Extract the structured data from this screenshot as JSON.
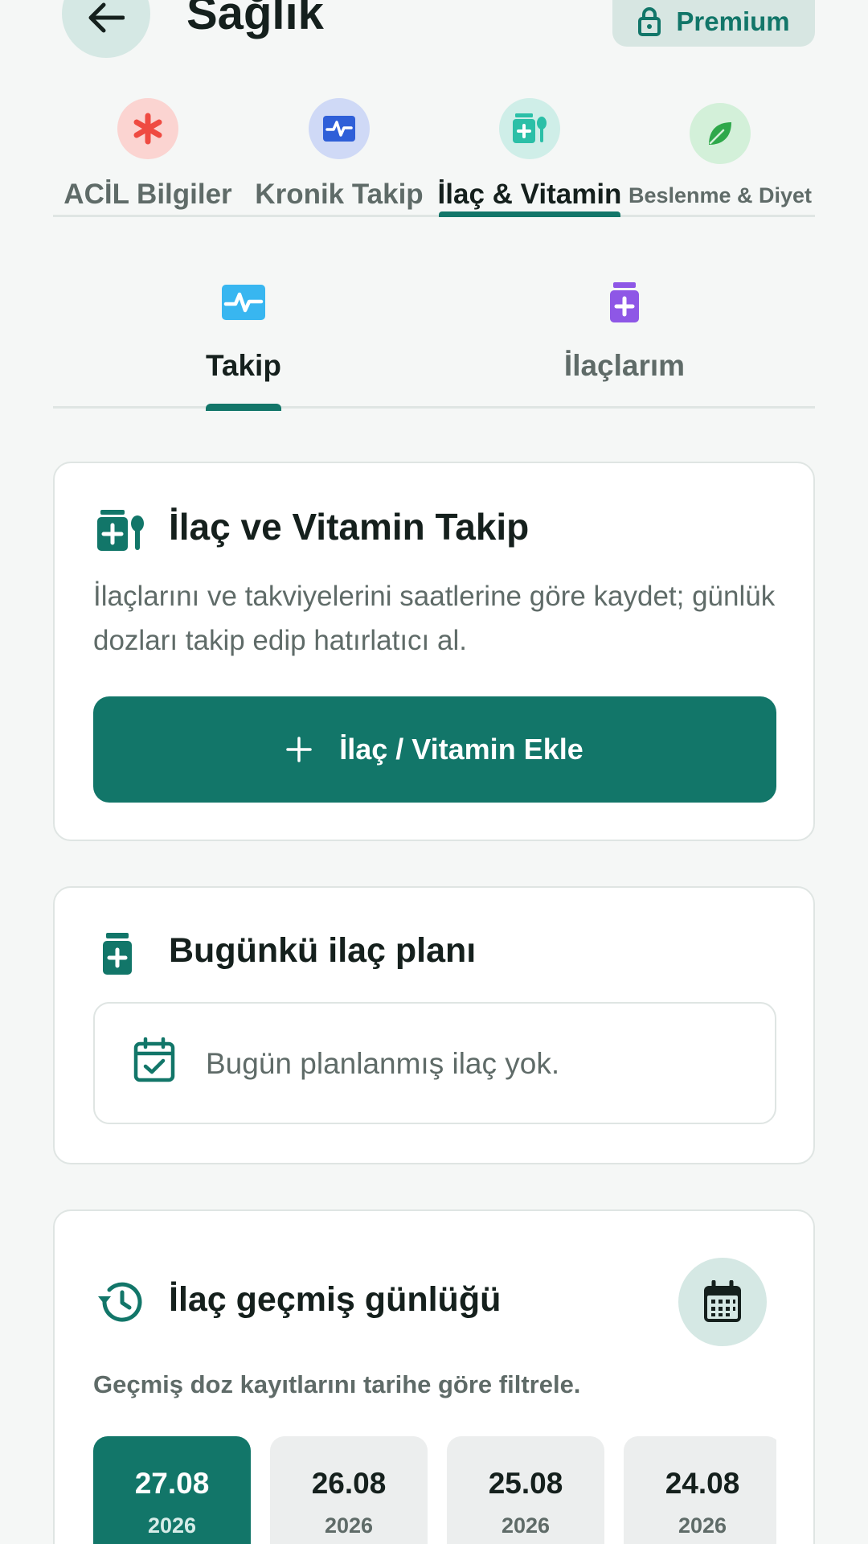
{
  "header": {
    "title": "Sağlık",
    "back_icon": "arrow-left-icon",
    "premium_label": "Premium",
    "premium_icon": "lock-icon"
  },
  "category_tabs": [
    {
      "label": "ACİL Bilgiler",
      "icon": "asterisk-icon",
      "color": "#ef4b42",
      "bg": "#fbd4d1"
    },
    {
      "label": "Kronik Takip",
      "icon": "heart-monitor-icon",
      "color": "#2f5fd8",
      "bg": "#cfd9f6"
    },
    {
      "label": "İlaç & Vitamin",
      "icon": "medicine-bottle-icon",
      "color": "#2bbfa7",
      "bg": "#cfeee8",
      "active": true
    },
    {
      "label": "Beslenme & Diyet",
      "icon": "leaf-icon",
      "color": "#2ea84a",
      "bg": "#d3f0d9"
    }
  ],
  "sub_tabs": [
    {
      "label": "Takip",
      "icon": "activity-icon",
      "color": "#38b6f0",
      "active": true
    },
    {
      "label": "İlaçlarım",
      "icon": "pill-bottle-icon",
      "color": "#8e57e6"
    }
  ],
  "tracking_card": {
    "title": "İlaç ve Vitamin Takip",
    "description": "İlaçlarını ve takviyelerini saatlerine göre kaydet; günlük dozları takip edip hatırlatıcı al.",
    "add_button_label": "İlaç / Vitamin Ekle"
  },
  "today_card": {
    "title": "Bugünkü ilaç planı",
    "empty_text": "Bugün planlanmış ilaç yok."
  },
  "history_card": {
    "title": "İlaç geçmiş günlüğü",
    "subtitle": "Geçmiş doz kayıtlarını tarihe göre filtrele.",
    "dates": [
      {
        "day": "27.08",
        "year": "2026",
        "selected": true
      },
      {
        "day": "26.08",
        "year": "2026"
      },
      {
        "day": "25.08",
        "year": "2026"
      },
      {
        "day": "24.08",
        "year": "2026"
      }
    ]
  },
  "colors": {
    "primary": "#127669",
    "background": "#f5f7f6",
    "text": "#15201d",
    "muted": "#5f6b68"
  }
}
